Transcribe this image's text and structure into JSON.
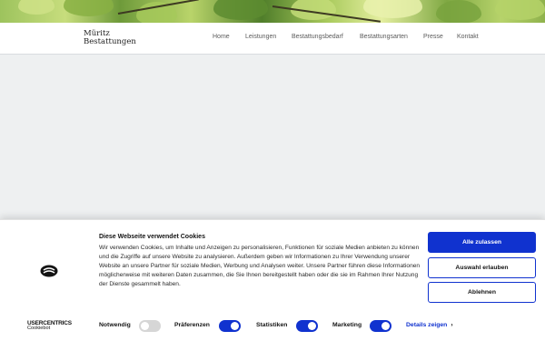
{
  "header": {
    "logo_line1": "Müritz",
    "logo_line2": "Bestattungen",
    "nav": [
      {
        "label": "Home"
      },
      {
        "label": "Leistungen"
      },
      {
        "label": "Bestattungsbedarf"
      },
      {
        "label": "Bestattungsarten"
      },
      {
        "label": "Presse"
      },
      {
        "label": "Kontakt"
      }
    ]
  },
  "cookie_banner": {
    "title": "Diese Webseite verwendet Cookies",
    "body": "Wir verwenden Cookies, um Inhalte und Anzeigen zu personalisieren, Funktionen für soziale Medien anbieten zu können und die Zugriffe auf unsere Website zu analysieren. Außerdem geben wir Informationen zu Ihrer Verwendung unserer Website an unsere Partner für soziale Medien, Werbung und Analysen weiter. Unsere Partner führen diese Informationen möglicherweise mit weiteren Daten zusammen, die Sie Ihnen bereitgestellt haben oder die sie im Rahmen Ihrer Nutzung der Dienste gesammelt haben.",
    "buttons": {
      "allow_all": "Alle zulassen",
      "allow_selection": "Auswahl erlauben",
      "deny": "Ablehnen"
    },
    "branding": {
      "brand": "USERCENTRICS",
      "sub": "Cookiebot"
    },
    "toggles": [
      {
        "label": "Notwendig",
        "state": "on",
        "locked": true
      },
      {
        "label": "Präferenzen",
        "state": "on"
      },
      {
        "label": "Statistiken",
        "state": "on"
      },
      {
        "label": "Marketing",
        "state": "on"
      }
    ],
    "details_link": "Details zeigen",
    "accent_color": "#1032cf"
  }
}
